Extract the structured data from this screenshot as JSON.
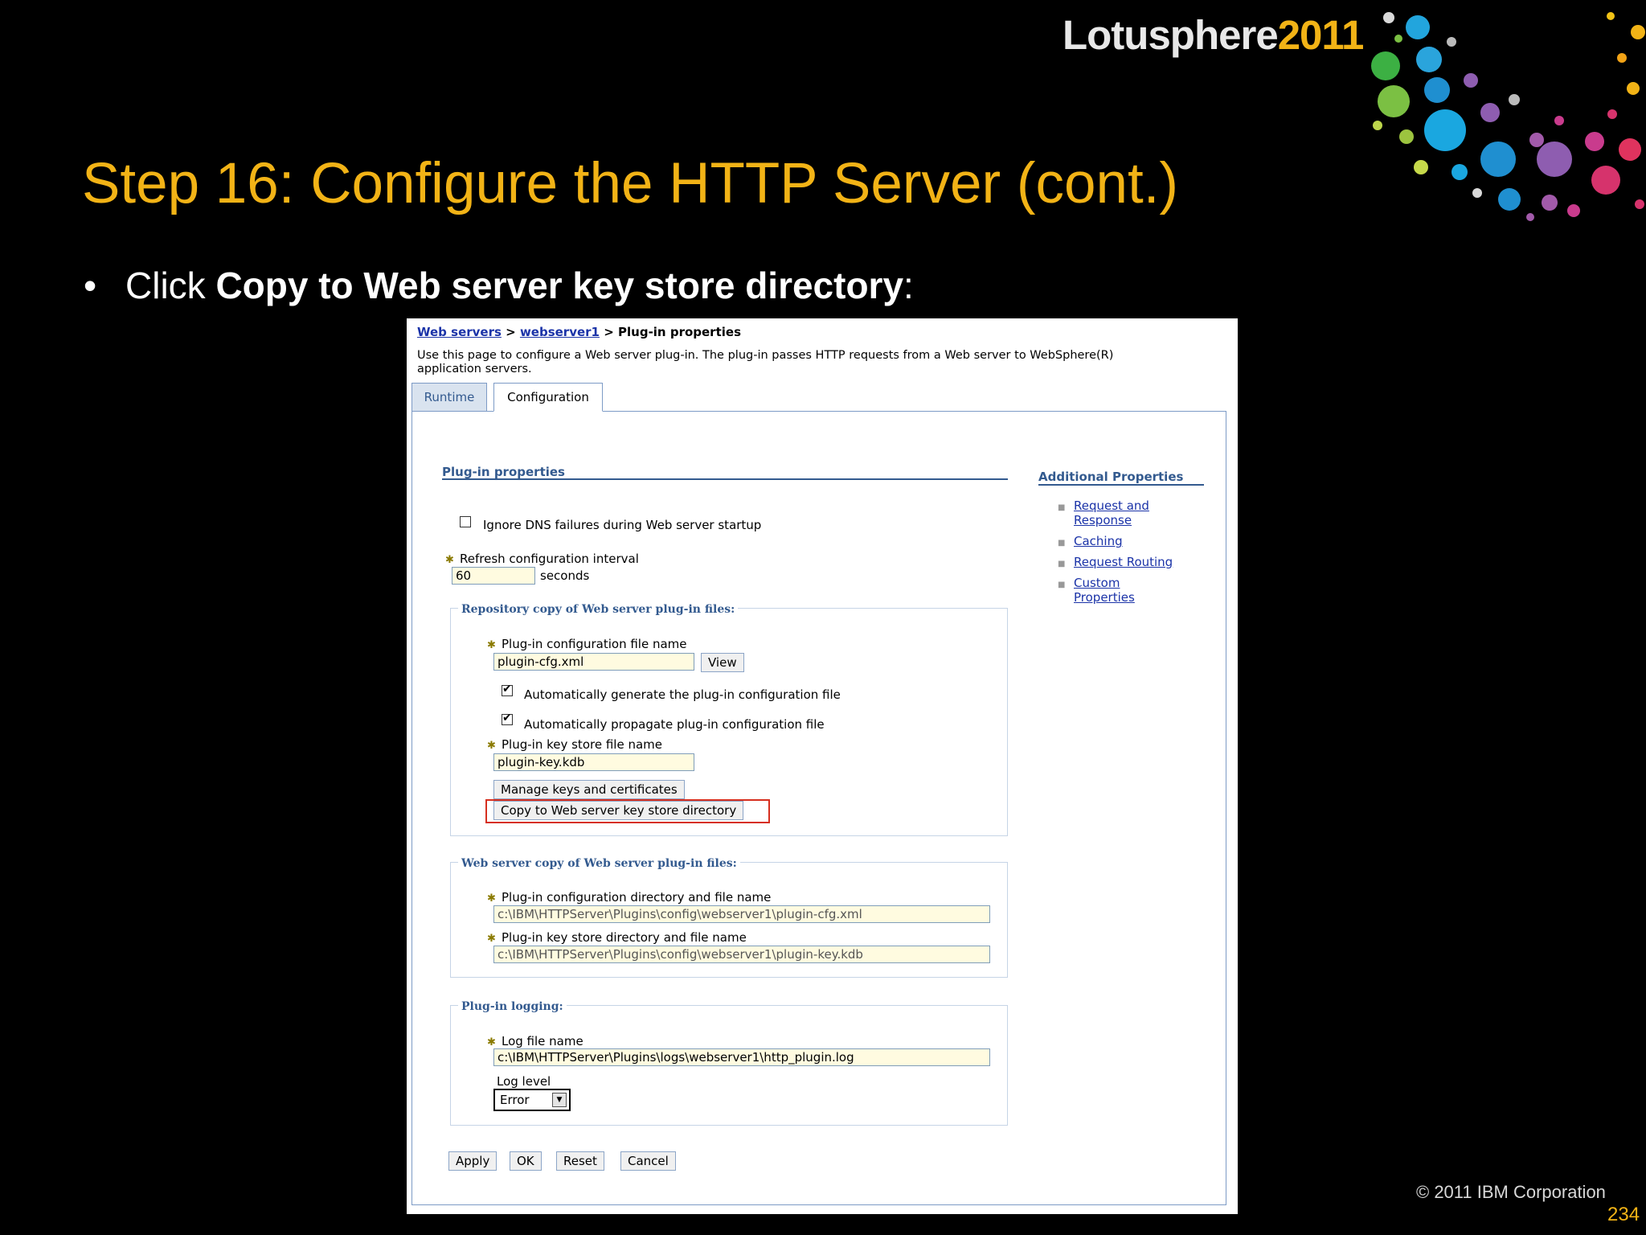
{
  "brand": {
    "name": "Lotusphere",
    "year": "2011"
  },
  "slide": {
    "title": "Step 16: Configure the HTTP Server (cont.)",
    "bullet_prefix": "Click ",
    "bullet_bold": "Copy to Web server key store directory",
    "bullet_suffix": ":",
    "copyright": "© 2011 IBM Corporation",
    "page_number": "234"
  },
  "shot": {
    "breadcrumb": {
      "item1": "Web servers",
      "sep1": " > ",
      "item2": "webserver1",
      "sep2": " > ",
      "current": "Plug-in properties"
    },
    "description_line1": "Use this page to configure a Web server plug-in. The plug-in passes HTTP requests from a Web server to WebSphere(R)",
    "description_line2": "application servers.",
    "tabs": {
      "runtime": "Runtime",
      "configuration": "Configuration"
    },
    "section_title": "Plug-in properties",
    "ignore_dns_label": "Ignore DNS failures during Web server startup",
    "refresh_label": "Refresh configuration interval",
    "refresh_value": "60",
    "refresh_unit": "seconds",
    "repo_group": {
      "legend": "Repository copy of Web server plug-in files:",
      "config_file_label": "Plug-in configuration file name",
      "config_file_value": "plugin-cfg.xml",
      "view_button": "View",
      "auto_generate_label": "Automatically generate the plug-in configuration file",
      "auto_propagate_label": "Automatically propagate plug-in configuration file",
      "keystore_label": "Plug-in key store file name",
      "keystore_value": "plugin-key.kdb",
      "manage_keys_button": "Manage keys and certificates",
      "copy_button": "Copy to Web server key store directory"
    },
    "webserver_group": {
      "legend": "Web server copy of Web server plug-in files:",
      "config_dir_label": "Plug-in configuration directory and file name",
      "config_dir_value": "c:\\IBM\\HTTPServer\\Plugins\\config\\webserver1\\plugin-cfg.xml",
      "keystore_dir_label": "Plug-in key store directory and file name",
      "keystore_dir_value": "c:\\IBM\\HTTPServer\\Plugins\\config\\webserver1\\plugin-key.kdb"
    },
    "logging_group": {
      "legend": "Plug-in logging:",
      "log_file_label": "Log file name",
      "log_file_value": "c:\\IBM\\HTTPServer\\Plugins\\logs\\webserver1\\http_plugin.log",
      "log_level_label": "Log level",
      "log_level_value": "Error"
    },
    "buttons": {
      "apply": "Apply",
      "ok": "OK",
      "reset": "Reset",
      "cancel": "Cancel"
    },
    "additional": {
      "title": "Additional Properties",
      "link1_line1": "Request and",
      "link1_line2": "Response",
      "link2": "Caching",
      "link3": "Request Routing",
      "link4_line1": "Custom",
      "link4_line2": "Properties"
    }
  }
}
